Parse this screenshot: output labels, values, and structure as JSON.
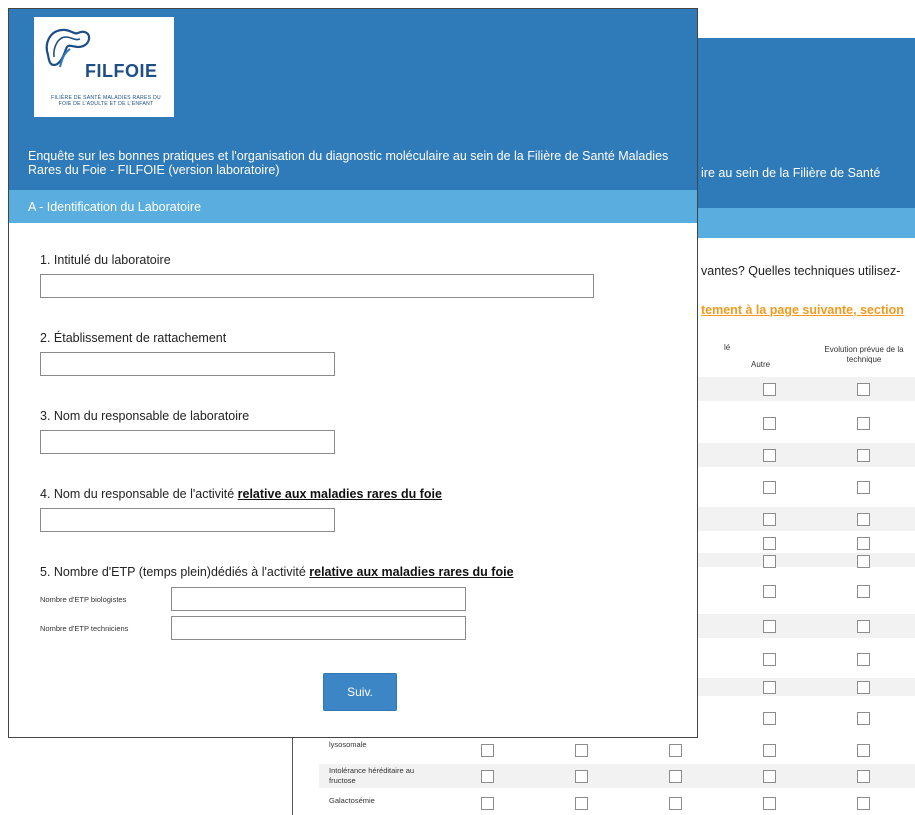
{
  "back_page": {
    "title_fragment": "ire au sein de la Filière de Santé",
    "question_fragment": "vantes? Quelles  techniques utilisez-",
    "link_fragment": "tement à la page suivante, section",
    "col_header_partial": "lé",
    "col_autre": "Autre",
    "col_evolution": "Evolution prévue de la technique",
    "rows": [
      {
        "label": "",
        "boxes": 2
      },
      {
        "label": "",
        "boxes": 2
      },
      {
        "label": "",
        "boxes": 2
      },
      {
        "label": "",
        "boxes": 2
      },
      {
        "label": "",
        "boxes": 2
      },
      {
        "label": "",
        "boxes": 2
      },
      {
        "label": "",
        "boxes": 2
      },
      {
        "label": "",
        "boxes": 2
      },
      {
        "label": "",
        "boxes": 2
      },
      {
        "label": "",
        "boxes": 2
      },
      {
        "label": "",
        "boxes": 2
      },
      {
        "label": "",
        "boxes": 2
      },
      {
        "label": "lysosomale",
        "boxes": 5
      },
      {
        "label": "Intolérance héréditaire au fructose",
        "boxes": 5
      },
      {
        "label": "Galactosémie",
        "boxes": 5
      }
    ]
  },
  "front_page": {
    "logo": {
      "word": "FILFOIE",
      "subtitle": "FILIÈRE DE SANTÉ MALADIES RARES DU FOIE DE L'ADULTE ET DE L'ENFANT",
      "icon": "liver-logo-icon"
    },
    "title": "Enquête sur les bonnes pratiques et l'organisation du diagnostic moléculaire au sein de la Filière de Santé Maladies Rares du Foie - FILFOIE (version laboratoire)",
    "section_title": "A - Identification du Laboratoire",
    "q1": {
      "label": "1. Intitulé du laboratoire",
      "value": ""
    },
    "q2": {
      "label": "2. Établissement de rattachement",
      "value": ""
    },
    "q3": {
      "label": "3. Nom du responsable de laboratoire",
      "value": ""
    },
    "q4": {
      "label_prefix": "4. Nom du responsable de l'activité ",
      "label_emph": "relative aux maladies rares du foie",
      "value": ""
    },
    "q5": {
      "label_prefix": "5. Nombre d'ETP (temps plein)dédiés à l'activité ",
      "label_emph": "relative aux maladies rares du foie",
      "sub1": {
        "label": "Nombre d'ETP biologistes",
        "value": ""
      },
      "sub2": {
        "label": "Nombre d'ETP techniciens",
        "value": ""
      }
    },
    "next_button": "Suiv."
  }
}
